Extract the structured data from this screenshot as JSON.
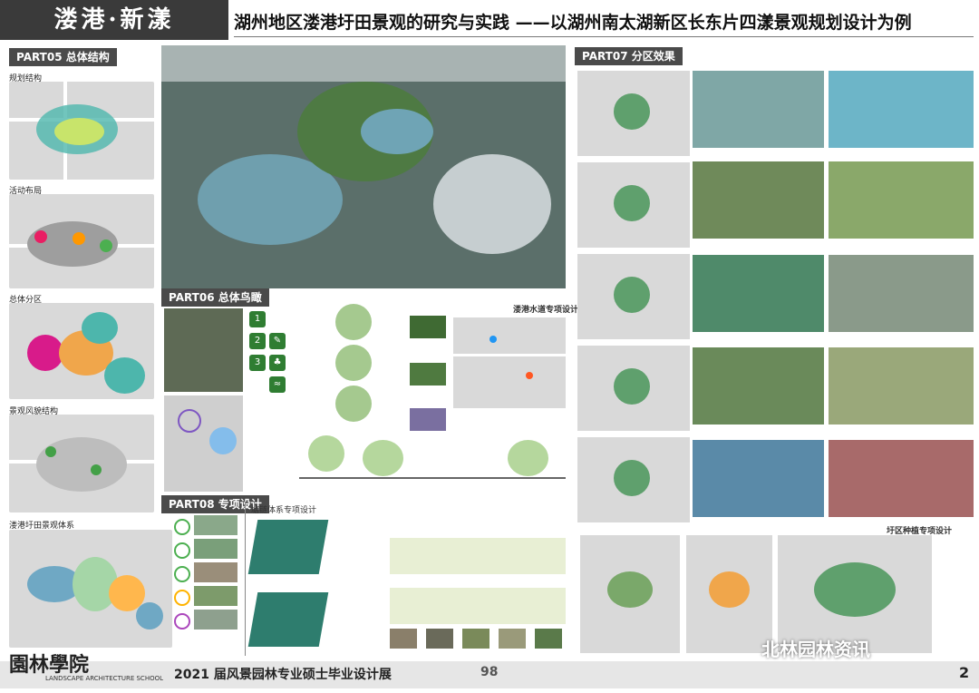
{
  "header": {
    "brand": "溇港·新漾",
    "title": "湖州地区溇港圩田景观的研究与实践 ——以湖州南太湖新区长东片四漾景观规划设计为例"
  },
  "sections": {
    "part05": "PART05 总体结构",
    "part06": "PART06 总体鸟瞰",
    "part07": "PART07 分区效果",
    "part08": "PART08 专项设计"
  },
  "left_panels": [
    "规划结构",
    "活动布局",
    "总体分区",
    "景观风貌结构",
    "溇港圩田景观体系"
  ],
  "special": {
    "waterway": "溇港水道专项设计",
    "embank": "塘链体系专项设计",
    "planting": "圩区种植专项设计"
  },
  "footer": {
    "school": "園林學院",
    "school_en": "LANDSCAPE ARCHITECTURE SCHOOL",
    "exhibition": "2021 届风景园林专业硕士毕业设计展",
    "number": "98",
    "watermark": "北林园林资讯",
    "page": "2"
  },
  "colors": {
    "header_bg": "#3a3a3a",
    "tag_bg": "#4a4a4a",
    "water": "#6fa8c4",
    "green": "#5c9a4a"
  }
}
